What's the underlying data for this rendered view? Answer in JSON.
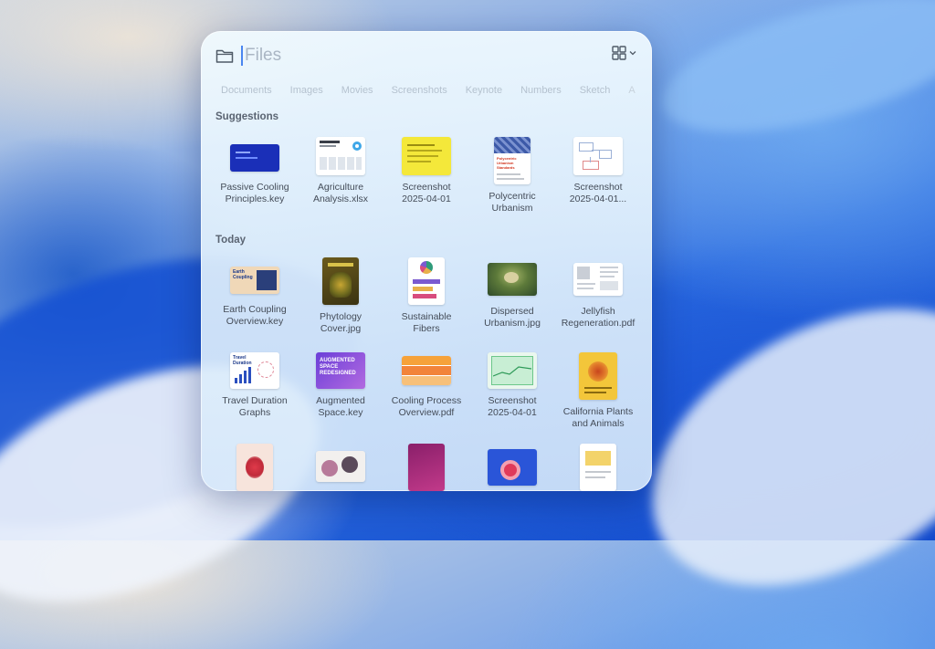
{
  "search": {
    "placeholder": "Files"
  },
  "filters": [
    "Documents",
    "Images",
    "Movies",
    "Screenshots",
    "Keynote",
    "Numbers",
    "Sketch",
    "A"
  ],
  "sections": {
    "suggestions": {
      "title": "Suggestions",
      "items": [
        {
          "line1": "Passive Cooling",
          "line2": "Principles.key"
        },
        {
          "line1": "Agriculture",
          "line2": "Analysis.xlsx"
        },
        {
          "line1": "Screenshot",
          "line2": "2025-04-01"
        },
        {
          "line1": "Polycentric",
          "line2": "Urbanism"
        },
        {
          "line1": "Screenshot",
          "line2": "2025-04-01..."
        }
      ]
    },
    "today": {
      "title": "Today",
      "rows": [
        [
          {
            "line1": "Earth Coupling",
            "line2": "Overview.key"
          },
          {
            "line1": "Phytology",
            "line2": "Cover.jpg"
          },
          {
            "line1": "Sustainable",
            "line2": "Fibers"
          },
          {
            "line1": "Dispersed",
            "line2": "Urbanism.jpg"
          },
          {
            "line1": "Jellyfish",
            "line2": "Regeneration.pdf"
          }
        ],
        [
          {
            "line1": "Travel Duration",
            "line2": "Graphs"
          },
          {
            "line1": "Augmented",
            "line2": "Space.key"
          },
          {
            "line1": "Cooling Process",
            "line2": "Overview.pdf"
          },
          {
            "line1": "Screenshot",
            "line2": "2025-04-01"
          },
          {
            "line1": "California Plants",
            "line2": "and Animals"
          }
        ]
      ]
    }
  },
  "thumb_text": {
    "earth": "Earth Coupling",
    "travel": "Travel Duration",
    "augmented": "AUGMENTED SPACE REDESIGNED",
    "polycentric": "Polycentric Urbanism Standards"
  },
  "colors": {
    "accent": "#4a86f0",
    "background": "#2a6ae0"
  }
}
